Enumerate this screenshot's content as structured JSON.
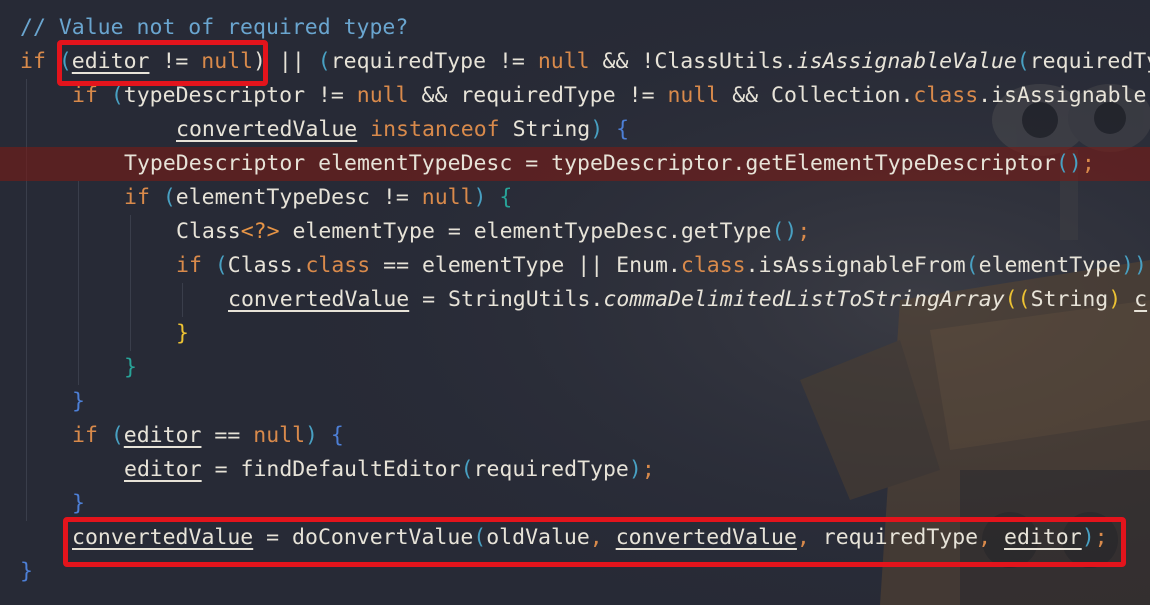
{
  "colors": {
    "background": "#272a36",
    "plain": "#e7e3d8",
    "keyword": "#d98a4b",
    "comment": "#6aa5cf",
    "paren": "#48a0c2",
    "brace_blue": "#4d7fd6",
    "brace_yellow": "#ecc233",
    "brace_teal": "#28a398",
    "generic": "#e69446",
    "annotation": "#e3141c",
    "current_line": "#6f1e18"
  },
  "code_lines": [
    {
      "indent": 0,
      "tokens": [
        {
          "t": "// Value not of required type?",
          "k": "comment"
        }
      ]
    },
    {
      "indent": 0,
      "tokens": [
        {
          "t": "if ",
          "k": "keyword"
        },
        {
          "t": "(",
          "k": "paren"
        },
        {
          "t": "editor",
          "k": "plain",
          "u": true
        },
        {
          "t": " != ",
          "k": "plain"
        },
        {
          "t": "null",
          "k": "keyword"
        },
        {
          "t": ") || ",
          "k": "plain"
        },
        {
          "t": "(",
          "k": "paren"
        },
        {
          "t": "requiredType != ",
          "k": "plain"
        },
        {
          "t": "null",
          "k": "keyword"
        },
        {
          "t": " && !ClassUtils.",
          "k": "plain"
        },
        {
          "t": "isAssignableValue",
          "k": "plain",
          "i": true
        },
        {
          "t": "(",
          "k": "paren"
        },
        {
          "t": "requiredTy",
          "k": "plain"
        }
      ]
    },
    {
      "indent": 1,
      "tokens": [
        {
          "t": "if ",
          "k": "keyword"
        },
        {
          "t": "(",
          "k": "paren"
        },
        {
          "t": "typeDescriptor != ",
          "k": "plain"
        },
        {
          "t": "null",
          "k": "keyword"
        },
        {
          "t": " && requiredType != ",
          "k": "plain"
        },
        {
          "t": "null",
          "k": "keyword"
        },
        {
          "t": " && Collection.",
          "k": "plain"
        },
        {
          "t": "class",
          "k": "keyword"
        },
        {
          "t": ".isAssignable",
          "k": "plain"
        }
      ]
    },
    {
      "indent": 3,
      "tokens": [
        {
          "t": "convertedValue",
          "k": "plain",
          "u": true
        },
        {
          "t": " ",
          "k": "plain"
        },
        {
          "t": "instanceof",
          "k": "keyword"
        },
        {
          "t": " String",
          "k": "plain"
        },
        {
          "t": ")",
          "k": "paren"
        },
        {
          "t": " {",
          "k": "brace_blue"
        }
      ]
    },
    {
      "indent": 2,
      "highlight": true,
      "tokens": [
        {
          "t": "TypeDescriptor elementTypeDesc = typeDescriptor.getElementTypeDescriptor",
          "k": "plain"
        },
        {
          "t": "()",
          "k": "paren"
        },
        {
          "t": ";",
          "k": "keyword"
        }
      ]
    },
    {
      "indent": 2,
      "tokens": [
        {
          "t": "if ",
          "k": "keyword"
        },
        {
          "t": "(",
          "k": "paren"
        },
        {
          "t": "elementTypeDesc != ",
          "k": "plain"
        },
        {
          "t": "null",
          "k": "keyword"
        },
        {
          "t": ")",
          "k": "paren"
        },
        {
          "t": " {",
          "k": "brace_teal"
        }
      ]
    },
    {
      "indent": 3,
      "tokens": [
        {
          "t": "Class",
          "k": "plain"
        },
        {
          "t": "<?>",
          "k": "generic"
        },
        {
          "t": " elementType = elementTypeDesc.getType",
          "k": "plain"
        },
        {
          "t": "()",
          "k": "paren"
        },
        {
          "t": ";",
          "k": "keyword"
        }
      ]
    },
    {
      "indent": 3,
      "tokens": [
        {
          "t": "if ",
          "k": "keyword"
        },
        {
          "t": "(",
          "k": "paren"
        },
        {
          "t": "Class.",
          "k": "plain"
        },
        {
          "t": "class",
          "k": "keyword"
        },
        {
          "t": " == elementType || Enum.",
          "k": "plain"
        },
        {
          "t": "class",
          "k": "keyword"
        },
        {
          "t": ".isAssignableFrom",
          "k": "plain"
        },
        {
          "t": "(",
          "k": "paren"
        },
        {
          "t": "elementType",
          "k": "plain"
        },
        {
          "t": "))",
          "k": "paren"
        }
      ]
    },
    {
      "indent": 4,
      "tokens": [
        {
          "t": "convertedValue",
          "k": "plain",
          "u": true
        },
        {
          "t": " = StringUtils.",
          "k": "plain"
        },
        {
          "t": "commaDelimitedListToStringArray",
          "k": "plain",
          "i": true
        },
        {
          "t": "((",
          "k": "brace_yellow"
        },
        {
          "t": "String",
          "k": "plain"
        },
        {
          "t": ") ",
          "k": "brace_yellow"
        },
        {
          "t": "c",
          "k": "plain",
          "u": true
        }
      ]
    },
    {
      "indent": 3,
      "tokens": [
        {
          "t": "}",
          "k": "brace_yellow"
        }
      ]
    },
    {
      "indent": 2,
      "tokens": [
        {
          "t": "}",
          "k": "brace_teal"
        }
      ]
    },
    {
      "indent": 1,
      "tokens": [
        {
          "t": "}",
          "k": "brace_blue"
        }
      ]
    },
    {
      "indent": 1,
      "tokens": [
        {
          "t": "if ",
          "k": "keyword"
        },
        {
          "t": "(",
          "k": "paren"
        },
        {
          "t": "editor",
          "k": "plain",
          "u": true
        },
        {
          "t": " == ",
          "k": "plain"
        },
        {
          "t": "null",
          "k": "keyword"
        },
        {
          "t": ")",
          "k": "paren"
        },
        {
          "t": " {",
          "k": "brace_blue"
        }
      ]
    },
    {
      "indent": 2,
      "tokens": [
        {
          "t": "editor",
          "k": "plain",
          "u": true
        },
        {
          "t": " = findDefaultEditor",
          "k": "plain"
        },
        {
          "t": "(",
          "k": "paren"
        },
        {
          "t": "requiredType",
          "k": "plain"
        },
        {
          "t": ")",
          "k": "paren"
        },
        {
          "t": ";",
          "k": "keyword"
        }
      ]
    },
    {
      "indent": 1,
      "tokens": [
        {
          "t": "}",
          "k": "brace_blue"
        }
      ]
    },
    {
      "indent": 1,
      "tokens": [
        {
          "t": "convertedValue",
          "k": "plain",
          "u": true
        },
        {
          "t": " = doConvertValue",
          "k": "plain"
        },
        {
          "t": "(",
          "k": "paren"
        },
        {
          "t": "oldValue",
          "k": "plain"
        },
        {
          "t": ", ",
          "k": "keyword"
        },
        {
          "t": "convertedValue",
          "k": "plain",
          "u": true
        },
        {
          "t": ", ",
          "k": "keyword"
        },
        {
          "t": "requiredType",
          "k": "plain"
        },
        {
          "t": ", ",
          "k": "keyword"
        },
        {
          "t": "editor",
          "k": "plain",
          "u": true
        },
        {
          "t": ")",
          "k": "paren"
        },
        {
          "t": ";",
          "k": "keyword"
        }
      ]
    },
    {
      "indent": 0,
      "tokens": [
        {
          "t": "}",
          "k": "brace_blue"
        }
      ]
    }
  ]
}
